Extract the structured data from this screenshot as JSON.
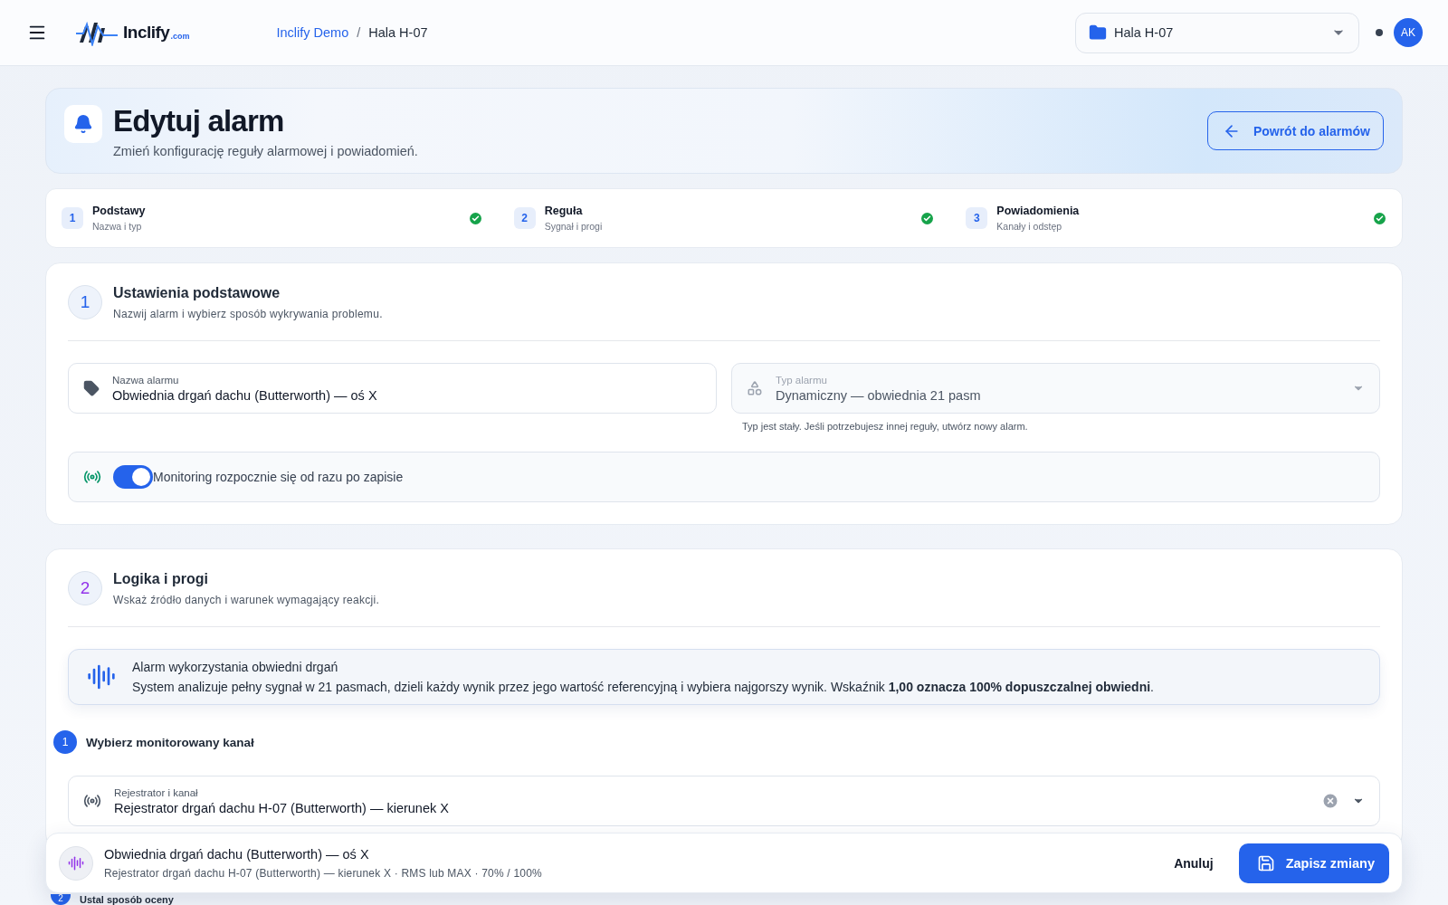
{
  "header": {
    "brand": "Inclify",
    "brand_suffix": ".com",
    "breadcrumb": [
      {
        "label": "Inclify Demo",
        "link": true
      },
      {
        "label": "Hala H-07",
        "link": false
      }
    ],
    "breadcrumb_separator": "/",
    "site_select": {
      "value": "Hala H-07"
    },
    "avatar": "AK"
  },
  "hero": {
    "title": "Edytuj alarm",
    "subtitle": "Zmień konfigurację reguły alarmowej i powiadomień.",
    "back_button": "Powrót do alarmów"
  },
  "steps": [
    {
      "number": "1",
      "title": "Podstawy",
      "subtitle": "Nazwa i typ",
      "done": true
    },
    {
      "number": "2",
      "title": "Reguła",
      "subtitle": "Sygnał i progi",
      "done": true
    },
    {
      "number": "3",
      "title": "Powiadomienia",
      "subtitle": "Kanały i odstęp",
      "done": true
    }
  ],
  "basics": {
    "number": "1",
    "title": "Ustawienia podstawowe",
    "subtitle": "Nazwij alarm i wybierz sposób wykrywania problemu.",
    "name_field": {
      "label": "Nazwa alarmu",
      "value": "Obwiednia drgań dachu (Butterworth) — oś X"
    },
    "type_field": {
      "label": "Typ alarmu",
      "value": "Dynamiczny — obwiednia 21 pasm",
      "disabled": true,
      "hint": "Typ jest stały. Jeśli potrzebujesz innej reguły, utwórz nowy alarm."
    },
    "monitoring": {
      "label": "Monitoring rozpocznie się od razu po zapisie",
      "on": true
    }
  },
  "logic": {
    "number": "2",
    "title": "Logika i progi",
    "subtitle": "Wskaż źródło danych i warunek wymagający reakcji.",
    "info": {
      "title": "Alarm wykorzystania obwiedni drgań",
      "text": "System analizuje pełny sygnał w 21 pasmach, dzieli każdy wynik przez jego wartość referencyjną i wybiera najgorszy wynik. Wskaźnik **1,00 oznacza 100% dopuszczalnej obwiedni**."
    },
    "channel_step": {
      "number": "1",
      "title": "Wybierz monitorowany kanał"
    },
    "channel_field": {
      "label": "Rejestrator i kanał",
      "value": "Rejestrator drgań dachu H-07 (Butterworth) — kierunek X"
    },
    "next_step": {
      "number": "2",
      "title": "Ustal sposób oceny"
    }
  },
  "bottom_bar": {
    "title": "Obwiednia drgań dachu (Butterworth) — oś X",
    "subtitle": "Rejestrator drgań dachu H-07 (Butterworth) — kierunek X · RMS lub MAX · 70% / 100%",
    "cancel": "Anuluj",
    "save": "Zapisz zmiany"
  }
}
